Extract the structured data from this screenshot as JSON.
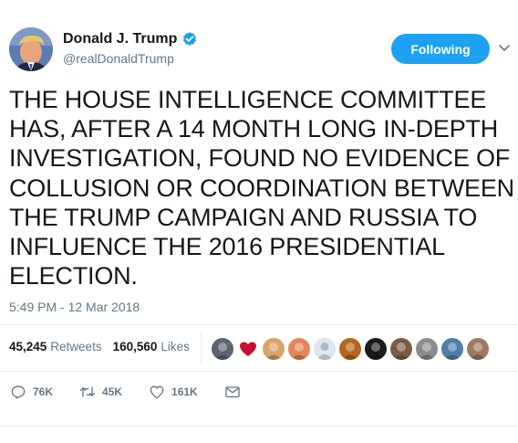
{
  "author": {
    "display_name": "Donald J. Trump",
    "handle": "@realDonaldTrump",
    "verified": true
  },
  "follow_button": {
    "label": "Following"
  },
  "tweet": {
    "text": "THE HOUSE INTELLIGENCE COMMITTEE\nHAS, AFTER A 14 MONTH LONG IN-DEPTH\nINVESTIGATION, FOUND NO EVIDENCE OF\nCOLLUSION OR COORDINATION BETWEEN\nTHE TRUMP CAMPAIGN AND RUSSIA TO\nINFLUENCE THE 2016 PRESIDENTIAL\nELECTION.",
    "timestamp": "5:49 PM - 12 Mar 2018"
  },
  "stats": {
    "retweets_count": "45,245",
    "retweets_label": "Retweets",
    "likes_count": "160,560",
    "likes_label": "Likes"
  },
  "liker_avatars": [
    {
      "icon": "user-avatar",
      "color": "#5b6470"
    },
    {
      "icon": "heart-avatar",
      "color": "#c8102e"
    },
    {
      "icon": "user-avatar",
      "color": "#d9a36a"
    },
    {
      "icon": "user-avatar",
      "color": "#e0875a"
    },
    {
      "icon": "default-avatar",
      "color": "#aab8c2"
    },
    {
      "icon": "fireworks-avatar",
      "color": "#b5651d"
    },
    {
      "icon": "dark-avatar",
      "color": "#1c1c1c"
    },
    {
      "icon": "user-avatar",
      "color": "#7a5c45"
    },
    {
      "icon": "group-avatar",
      "color": "#8c8c8c"
    },
    {
      "icon": "sea-avatar",
      "color": "#4f7fa8"
    },
    {
      "icon": "user-avatar",
      "color": "#a07860"
    }
  ],
  "actions": {
    "reply_count": "76K",
    "retweet_count": "45K",
    "like_count": "161K"
  },
  "colors": {
    "accent": "#1da1f2",
    "muted_text": "#657786",
    "divider": "#e6ecf0"
  }
}
